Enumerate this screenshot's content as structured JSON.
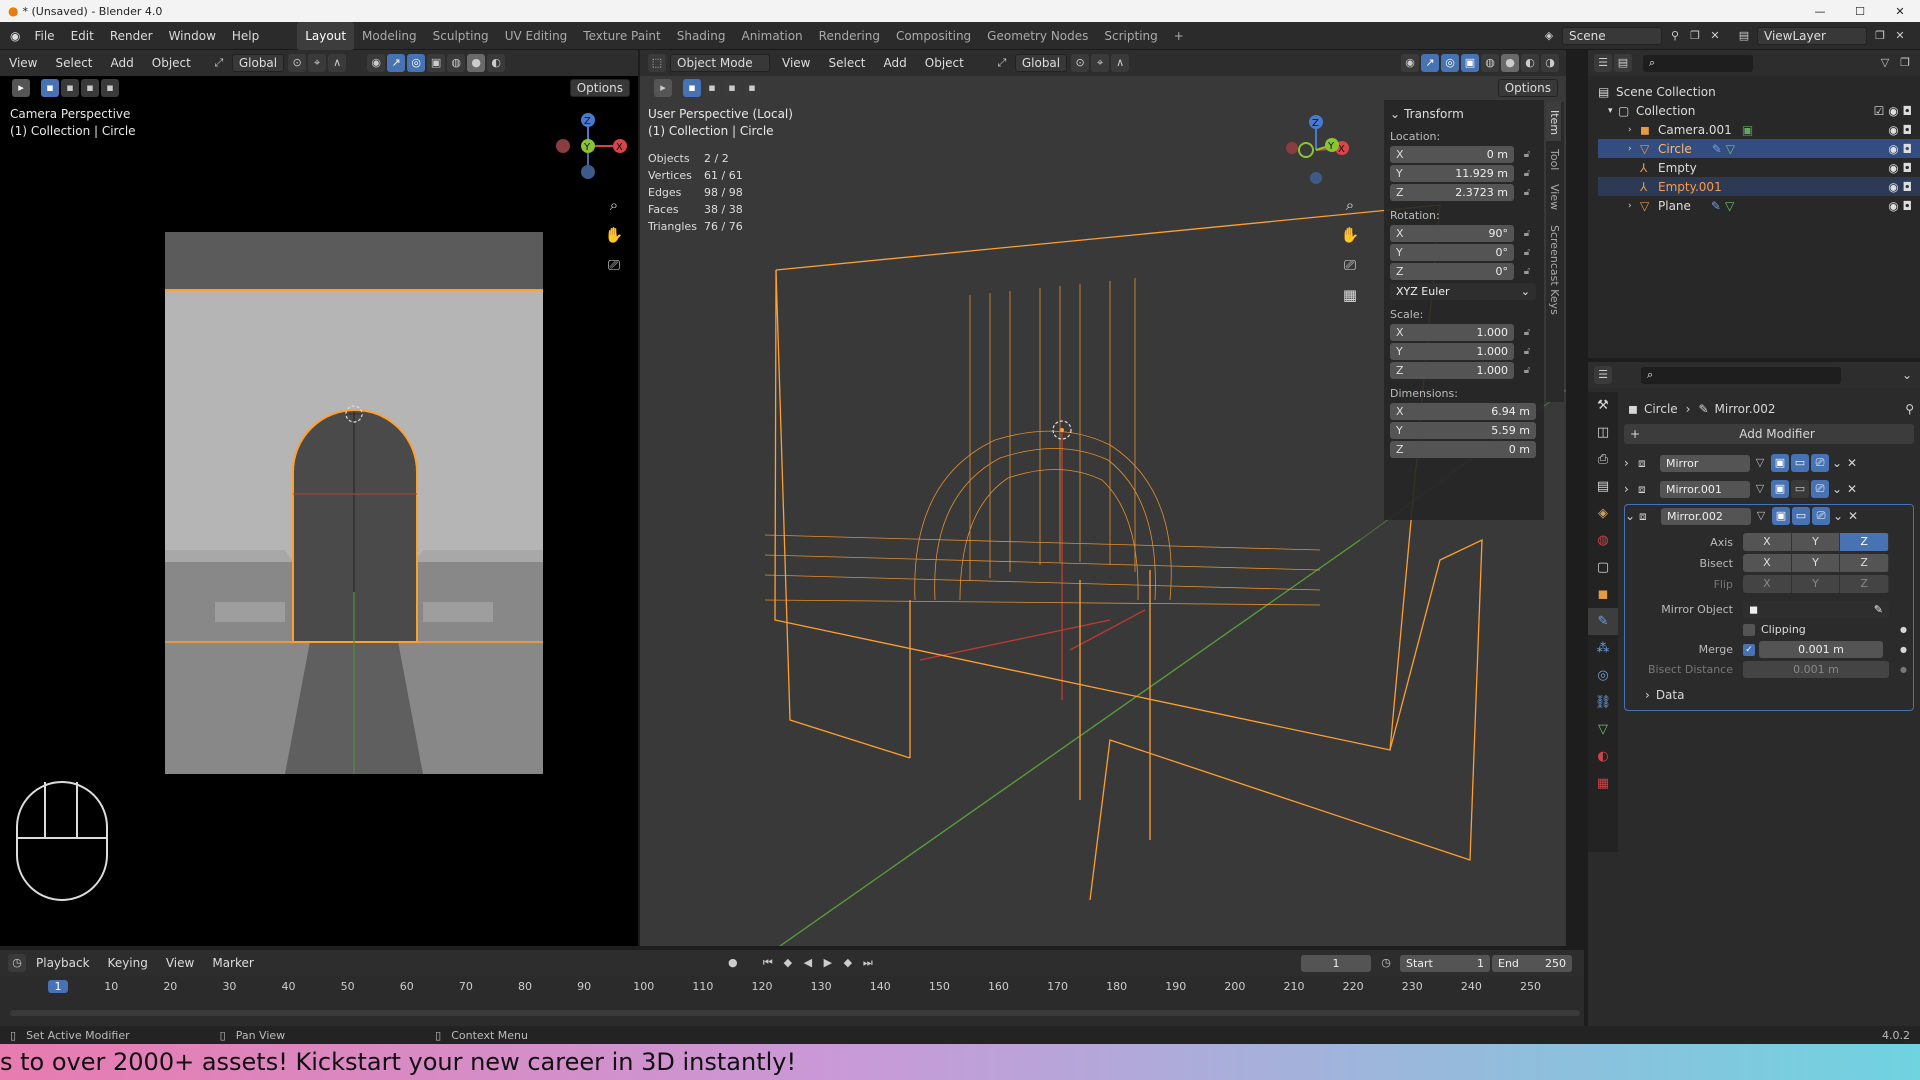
{
  "window": {
    "title": "* (Unsaved) - Blender 4.0"
  },
  "menu": [
    "File",
    "Edit",
    "Render",
    "Window",
    "Help"
  ],
  "workspaces": [
    "Layout",
    "Modeling",
    "Sculpting",
    "UV Editing",
    "Texture Paint",
    "Shading",
    "Animation",
    "Rendering",
    "Compositing",
    "Geometry Nodes",
    "Scripting"
  ],
  "scene": {
    "scene_label": "Scene",
    "viewlayer_label": "ViewLayer"
  },
  "left_view": {
    "menu": [
      "View",
      "Select",
      "Add",
      "Object"
    ],
    "orientation": "Global",
    "options": "Options",
    "title": "Camera Perspective",
    "subtitle": "(1) Collection | Circle"
  },
  "main_view": {
    "mode": "Object Mode",
    "menu": [
      "View",
      "Select",
      "Add",
      "Object"
    ],
    "orientation": "Global",
    "options": "Options",
    "title": "User Perspective (Local)",
    "subtitle": "(1) Collection | Circle",
    "stats": [
      {
        "k": "Objects",
        "v": "2 / 2"
      },
      {
        "k": "Vertices",
        "v": "61 / 61"
      },
      {
        "k": "Edges",
        "v": "98 / 98"
      },
      {
        "k": "Faces",
        "v": "38 / 38"
      },
      {
        "k": "Triangles",
        "v": "76 / 76"
      }
    ]
  },
  "gizmo": {
    "x": "X",
    "y": "Y",
    "z": "Z"
  },
  "npanel": {
    "header": "Transform",
    "location_label": "Location:",
    "location": [
      {
        "k": "X",
        "v": "0 m"
      },
      {
        "k": "Y",
        "v": "11.929 m"
      },
      {
        "k": "Z",
        "v": "2.3723 m"
      }
    ],
    "rotation_label": "Rotation:",
    "rotation": [
      {
        "k": "X",
        "v": "90°"
      },
      {
        "k": "Y",
        "v": "0°"
      },
      {
        "k": "Z",
        "v": "0°"
      }
    ],
    "rotation_mode": "XYZ Euler",
    "scale_label": "Scale:",
    "scale": [
      {
        "k": "X",
        "v": "1.000"
      },
      {
        "k": "Y",
        "v": "1.000"
      },
      {
        "k": "Z",
        "v": "1.000"
      }
    ],
    "dimensions_label": "Dimensions:",
    "dimensions": [
      {
        "k": "X",
        "v": "6.94 m"
      },
      {
        "k": "Y",
        "v": "5.59 m"
      },
      {
        "k": "Z",
        "v": "0 m"
      }
    ],
    "tabs": [
      "Item",
      "Tool",
      "View",
      "Screencast Keys"
    ]
  },
  "outliner": {
    "root": "Scene Collection",
    "collection": "Collection",
    "items": [
      {
        "name": "Camera.001"
      },
      {
        "name": "Circle"
      },
      {
        "name": "Empty"
      },
      {
        "name": "Empty.001"
      },
      {
        "name": "Plane"
      }
    ]
  },
  "properties": {
    "breadcrumb_object": "Circle",
    "breadcrumb_modifier": "Mirror.002",
    "add_modifier": "Add Modifier",
    "modifiers": [
      "Mirror",
      "Mirror.001",
      "Mirror.002"
    ],
    "axis_label": "Axis",
    "bisect_label": "Bisect",
    "flip_label": "Flip",
    "xyz": [
      "X",
      "Y",
      "Z"
    ],
    "mirror_object_label": "Mirror Object",
    "clipping_label": "Clipping",
    "merge_label": "Merge",
    "merge_value": "0.001 m",
    "bisect_distance_label": "Bisect Distance",
    "bisect_distance_value": "0.001 m",
    "data_label": "Data"
  },
  "timeline": {
    "menu": [
      "Playback",
      "Keying",
      "View",
      "Marker"
    ],
    "current_frame": "1",
    "start_label": "Start",
    "start": "1",
    "end_label": "End",
    "end": "250",
    "ticks": [
      "1",
      "10",
      "20",
      "30",
      "40",
      "50",
      "60",
      "70",
      "80",
      "90",
      "100",
      "110",
      "120",
      "130",
      "140",
      "150",
      "160",
      "170",
      "180",
      "190",
      "200",
      "210",
      "220",
      "230",
      "240",
      "250"
    ]
  },
  "statusbar": {
    "items": [
      "Set Active Modifier",
      "Pan View",
      "Context Menu"
    ],
    "version": "4.0.2"
  },
  "banner": {
    "text": "s to over 2000+ assets! Kickstart your new career in 3D instantly!"
  },
  "colors": {
    "accent": "#4772b3",
    "selection": "#ff9f2e",
    "banner_start": "#e87bb0",
    "banner_end": "#6fd3e0"
  }
}
